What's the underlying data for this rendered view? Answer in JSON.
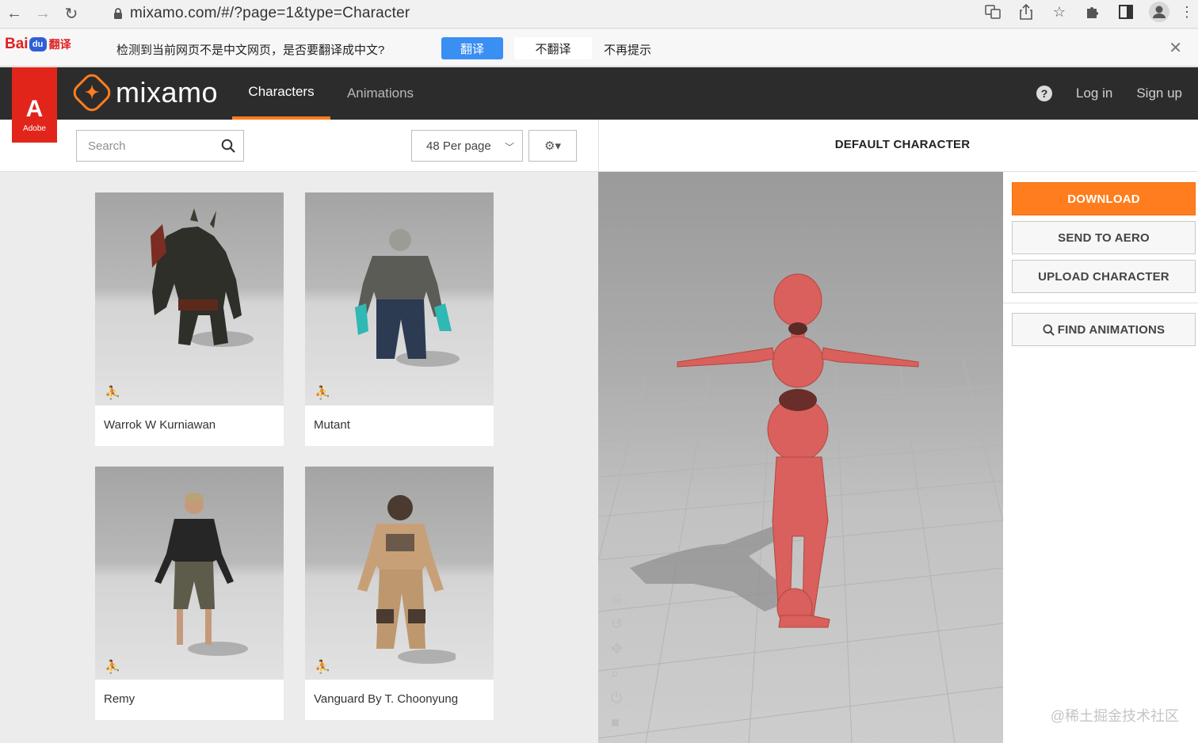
{
  "browser": {
    "url": "mixamo.com/#/?page=1&type=Character"
  },
  "translate_bar": {
    "brand": "Bai",
    "brand_paw": "du",
    "brand_product": "翻译",
    "message": "检测到当前网页不是中文网页，是否要翻译成中文?",
    "translate_label": "翻译",
    "no_translate_label": "不翻译",
    "never_label": "不再提示",
    "close_glyph": "✕"
  },
  "header": {
    "adobe_label": "Adobe",
    "adobe_glyph": "A",
    "logo_text": "mixamo",
    "tabs": [
      {
        "label": "Characters",
        "active": true
      },
      {
        "label": "Animations",
        "active": false
      }
    ],
    "help_glyph": "?",
    "login_label": "Log in",
    "signup_label": "Sign up"
  },
  "toolbar": {
    "search_placeholder": "Search",
    "per_page_value": "48 Per page",
    "settings_glyph": "⚙▾"
  },
  "characters": [
    {
      "name": "Warrok W Kurniawan"
    },
    {
      "name": "Mutant"
    },
    {
      "name": "Remy"
    },
    {
      "name": "Vanguard By T. Choonyung"
    }
  ],
  "viewer": {
    "title": "DEFAULT CHARACTER"
  },
  "actions": {
    "download_label": "DOWNLOAD",
    "send_label": "SEND TO AERO",
    "upload_label": "UPLOAD CHARACTER",
    "find_label": "FIND ANIMATIONS"
  },
  "colors": {
    "accent": "#ff7d1f",
    "header_bg": "#2c2c2c",
    "adobe_red": "#e1251b",
    "mannequin": "#d9605c"
  },
  "watermark": "@稀土掘金技术社区"
}
